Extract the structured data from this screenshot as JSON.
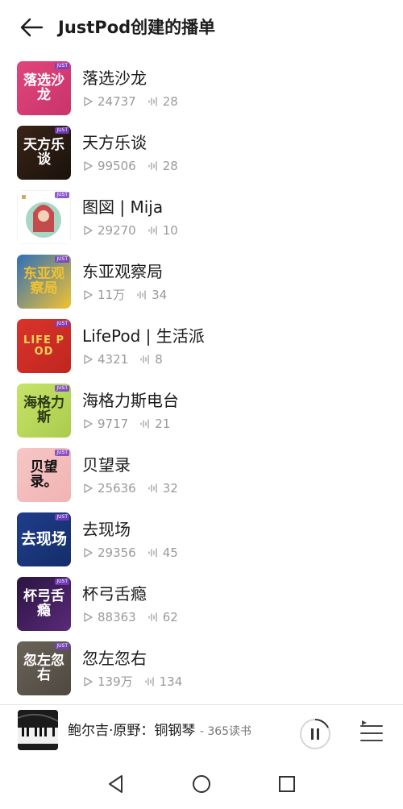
{
  "header": {
    "title": "JustPod创建的播单",
    "back_icon": "arrow-left-icon"
  },
  "playlists": [
    {
      "title": "落选沙龙",
      "plays": "24737",
      "episodes": "28",
      "cover_text": "落选沙龙",
      "colors": [
        "#e0457b",
        "#c9346a"
      ],
      "cover_fg": "#ffffff"
    },
    {
      "title": "天方乐谈",
      "plays": "99506",
      "episodes": "28",
      "cover_text": "天方乐谈",
      "colors": [
        "#3a2418",
        "#1a120c"
      ],
      "cover_fg": "#ffffff"
    },
    {
      "title": "图図 | Mija",
      "plays": "29270",
      "episodes": "10",
      "cover_text": "",
      "colors": [
        "#ffffff",
        "#f3f3f3"
      ],
      "cover_fg": "#c8323a"
    },
    {
      "title": "东亚观察局",
      "plays": "11万",
      "episodes": "34",
      "cover_text": "东亚观察局",
      "colors": [
        "#2f6fb8",
        "#f2c230"
      ],
      "cover_fg": "#f2c230"
    },
    {
      "title": "LifePod | 生活派",
      "plays": "4321",
      "episodes": "8",
      "cover_text": "LIFE POD",
      "colors": [
        "#d9332b",
        "#c0271f"
      ],
      "cover_fg": "#f6d25a"
    },
    {
      "title": "海格力斯电台",
      "plays": "9717",
      "episodes": "21",
      "cover_text": "海格力斯",
      "colors": [
        "#c7e36b",
        "#a9cc4c"
      ],
      "cover_fg": "#2d3a14"
    },
    {
      "title": "贝望录",
      "plays": "25636",
      "episodes": "32",
      "cover_text": "贝望录。",
      "colors": [
        "#f6c6c6",
        "#f1b3b3"
      ],
      "cover_fg": "#111111"
    },
    {
      "title": "去现场",
      "plays": "29356",
      "episodes": "45",
      "cover_text": "去现场",
      "colors": [
        "#1f3d8a",
        "#152d6a"
      ],
      "cover_fg": "#ffffff"
    },
    {
      "title": "杯弓舌瘾",
      "plays": "88363",
      "episodes": "62",
      "cover_text": "杯弓舌瘾",
      "colors": [
        "#2a1440",
        "#5a2a7a"
      ],
      "cover_fg": "#ffffff"
    },
    {
      "title": "忽左忽右",
      "plays": "139万",
      "episodes": "134",
      "cover_text": "忽左忽右",
      "colors": [
        "#6b6358",
        "#4e4840"
      ],
      "cover_fg": "#ffffff"
    }
  ],
  "cover_badge": "JUST",
  "icons": {
    "play": "play-count-icon",
    "episodes": "sound-wave-icon"
  },
  "player": {
    "title": "鲍尔吉·原野：铜钢琴",
    "subtitle": "- 365读书",
    "pause_icon": "pause-icon",
    "queue_icon": "playlist-queue-icon"
  },
  "navbar": {
    "back": "nav-back-icon",
    "home": "nav-home-icon",
    "recents": "nav-recents-icon"
  }
}
